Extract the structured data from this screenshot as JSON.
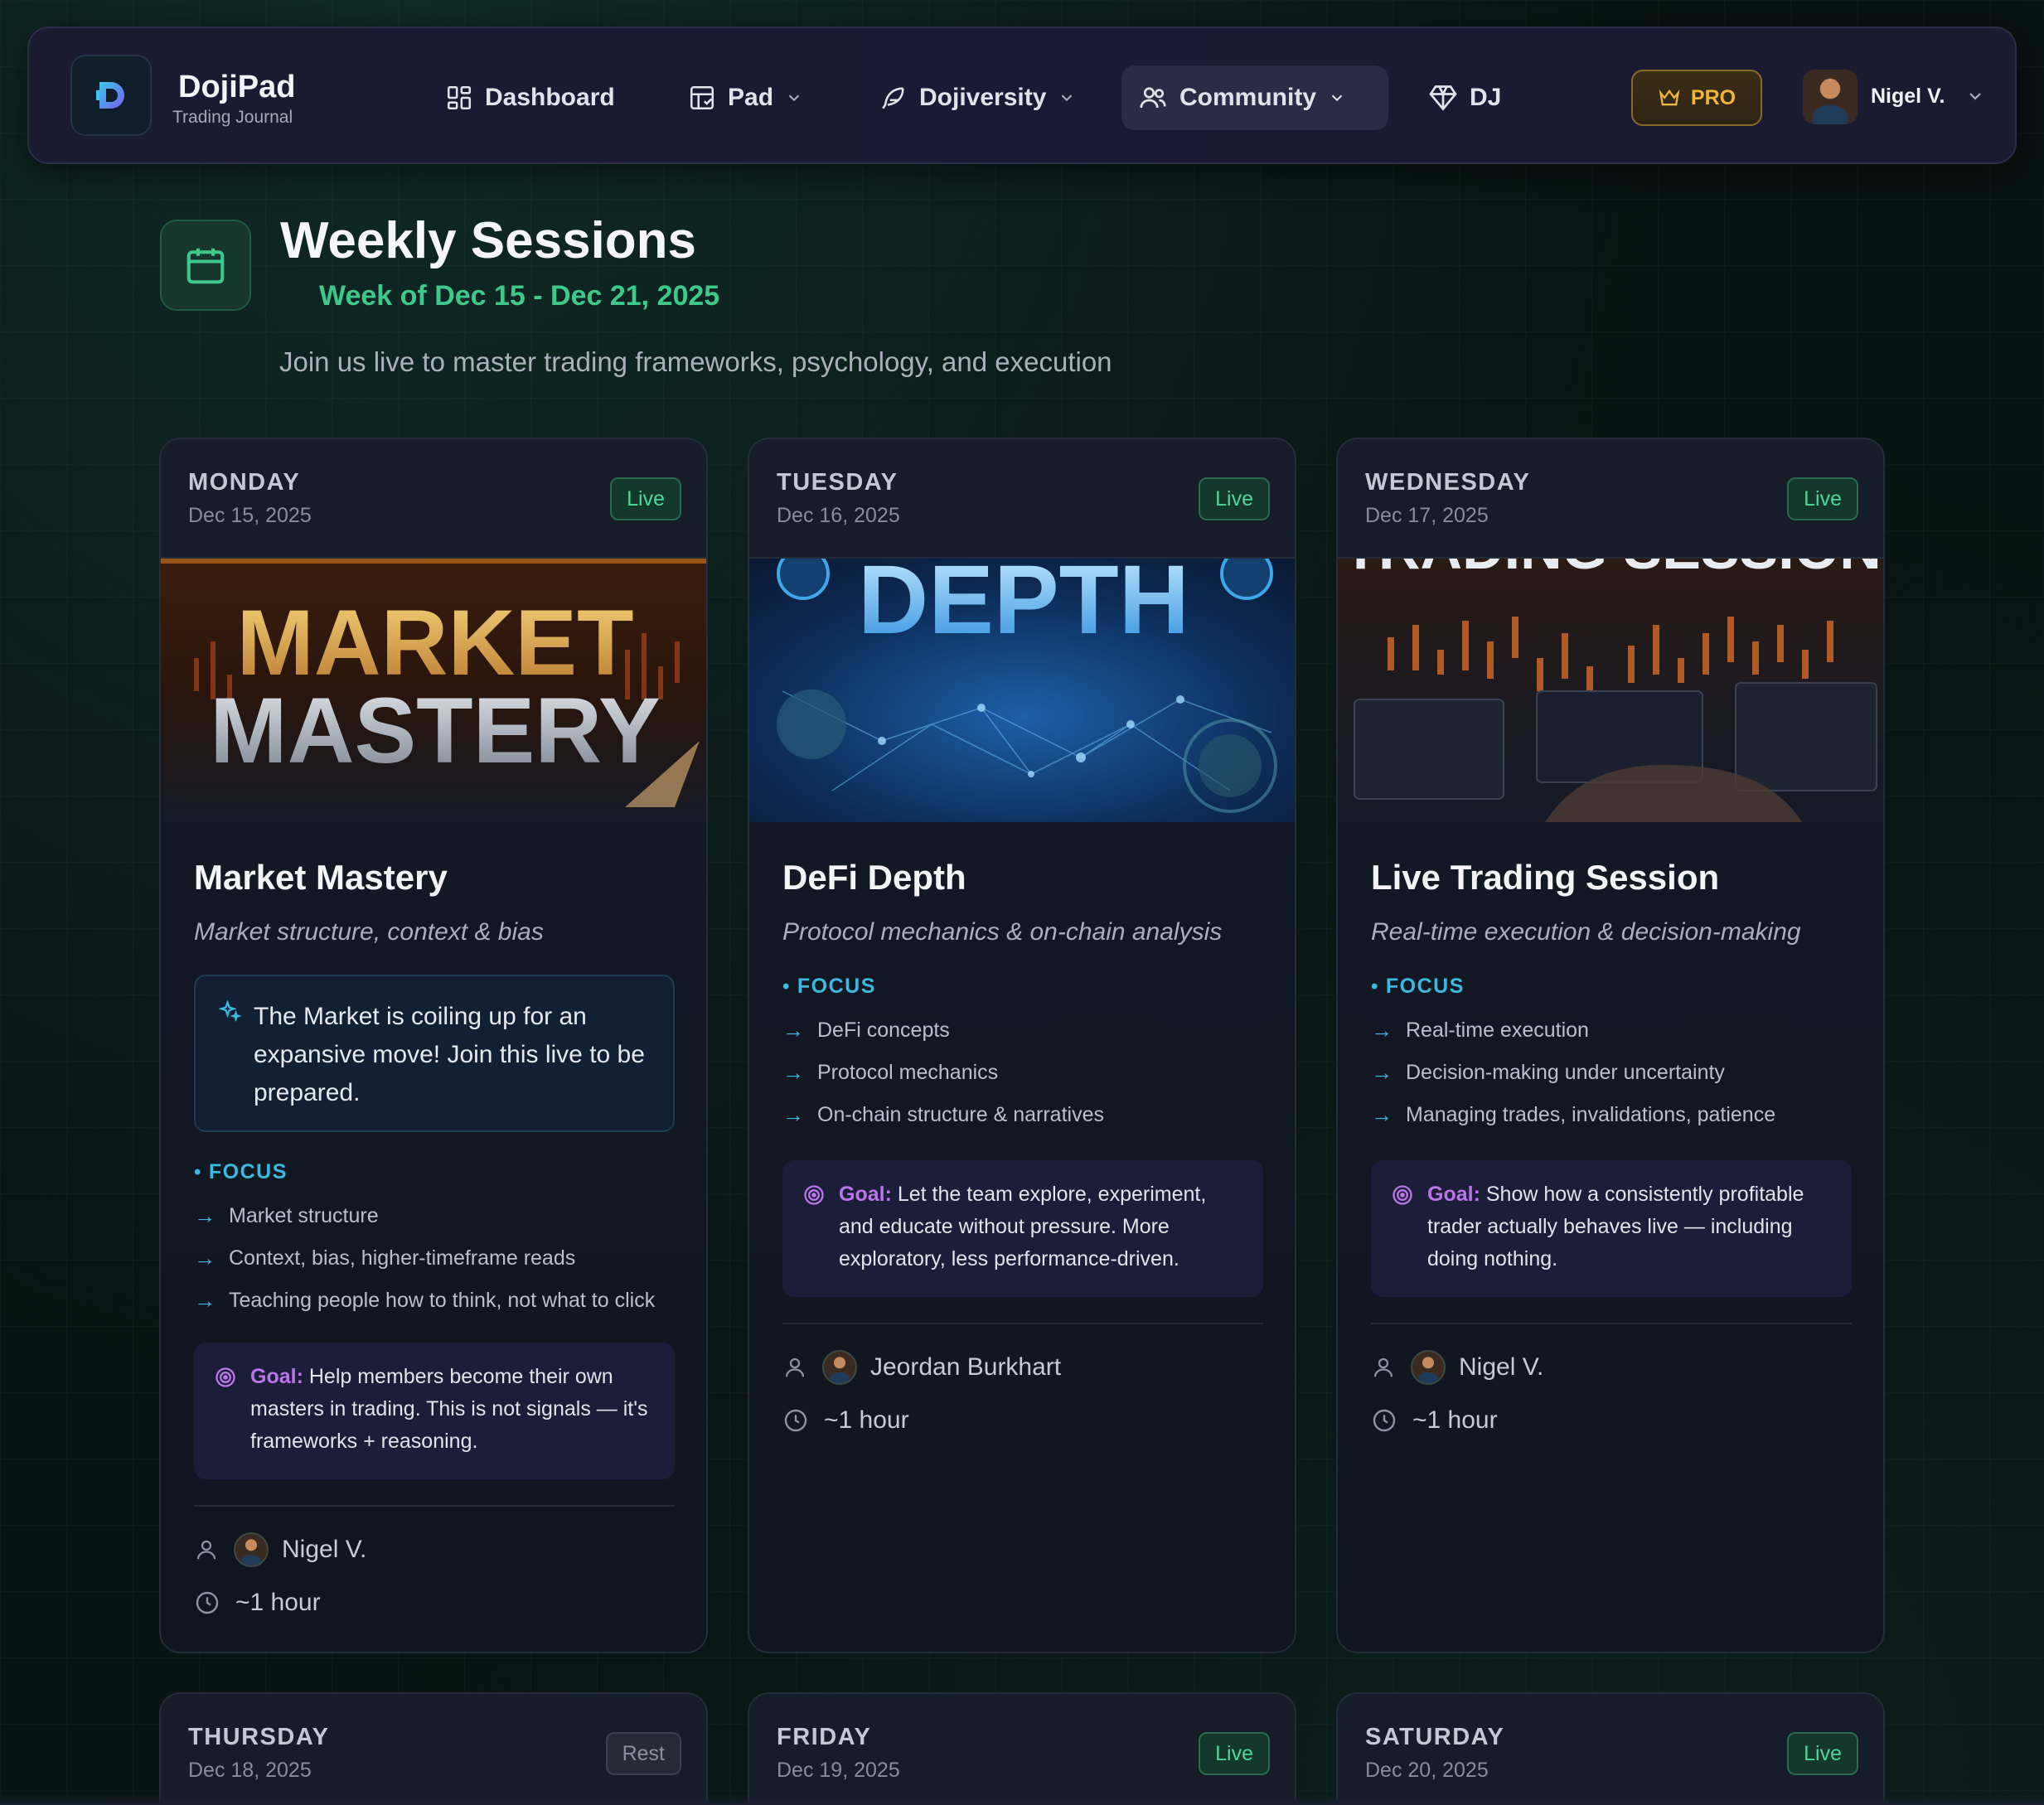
{
  "nav": {
    "brand_name": "DojiPad",
    "brand_sub": "Trading Journal",
    "items": [
      {
        "label": "Dashboard"
      },
      {
        "label": "Pad"
      },
      {
        "label": "Dojiversity"
      },
      {
        "label": "Community"
      },
      {
        "label": "DJ"
      }
    ],
    "pro_label": "PRO",
    "user_name": "Nigel V."
  },
  "header": {
    "title": "Weekly Sessions",
    "week": "Week of Dec 15 - Dec 21, 2025",
    "description": "Join us live to master trading frameworks, psychology, and execution"
  },
  "cards": [
    {
      "day": "MONDAY",
      "date": "Dec 15, 2025",
      "status": "Live",
      "banner_line1": "MARKET",
      "banner_line2": "MASTERY",
      "title": "Market Mastery",
      "subtitle": "Market structure, context & bias",
      "note": "The Market is coiling up for an expansive move! Join this live to be prepared.",
      "focus_label": "FOCUS",
      "focus": [
        "Market structure",
        "Context, bias, higher-timeframe reads",
        "Teaching people how to think, not what to click"
      ],
      "goal_label": "Goal:",
      "goal": "Help members become their own masters in trading. This is not signals — it's frameworks + reasoning.",
      "host": "Nigel V.",
      "duration": "~1 hour"
    },
    {
      "day": "TUESDAY",
      "date": "Dec 16, 2025",
      "status": "Live",
      "banner_text": "DEPTH",
      "title": "DeFi Depth",
      "subtitle": "Protocol mechanics & on-chain analysis",
      "focus_label": "FOCUS",
      "focus": [
        "DeFi concepts",
        "Protocol mechanics",
        "On-chain structure & narratives"
      ],
      "goal_label": "Goal:",
      "goal": "Let the team explore, experiment, and educate without pressure. More exploratory, less performance-driven.",
      "host": "Jeordan Burkhart",
      "duration": "~1 hour"
    },
    {
      "day": "WEDNESDAY",
      "date": "Dec 17, 2025",
      "status": "Live",
      "banner_text": "TRADING SESSION",
      "title": "Live Trading Session",
      "subtitle": "Real-time execution & decision-making",
      "focus_label": "FOCUS",
      "focus": [
        "Real-time execution",
        "Decision-making under uncertainty",
        "Managing trades, invalidations, patience"
      ],
      "goal_label": "Goal:",
      "goal": "Show how a consistently profitable trader actually behaves live — including doing nothing.",
      "host": "Nigel V.",
      "duration": "~1 hour"
    },
    {
      "day": "THURSDAY",
      "date": "Dec 18, 2025",
      "status": "Rest"
    },
    {
      "day": "FRIDAY",
      "date": "Dec 19, 2025",
      "status": "Live"
    },
    {
      "day": "SATURDAY",
      "date": "Dec 20, 2025",
      "status": "Live"
    }
  ],
  "colors": {
    "accent_green": "#3ec98b",
    "accent_cyan": "#3bb9e0",
    "goal_purple": "#b876e8",
    "pro_gold": "#f0b43c"
  },
  "icons": {
    "logo": "dojipad-logo-icon",
    "dashboard": "grid-icon",
    "pad": "layout-icon",
    "dojiversity": "feather-icon",
    "community": "users-icon",
    "dj": "gem-icon",
    "pro": "crown-icon",
    "header": "calendar-icon",
    "note": "sparkles-icon",
    "goal": "target-icon",
    "host": "person-icon",
    "duration": "clock-icon"
  }
}
